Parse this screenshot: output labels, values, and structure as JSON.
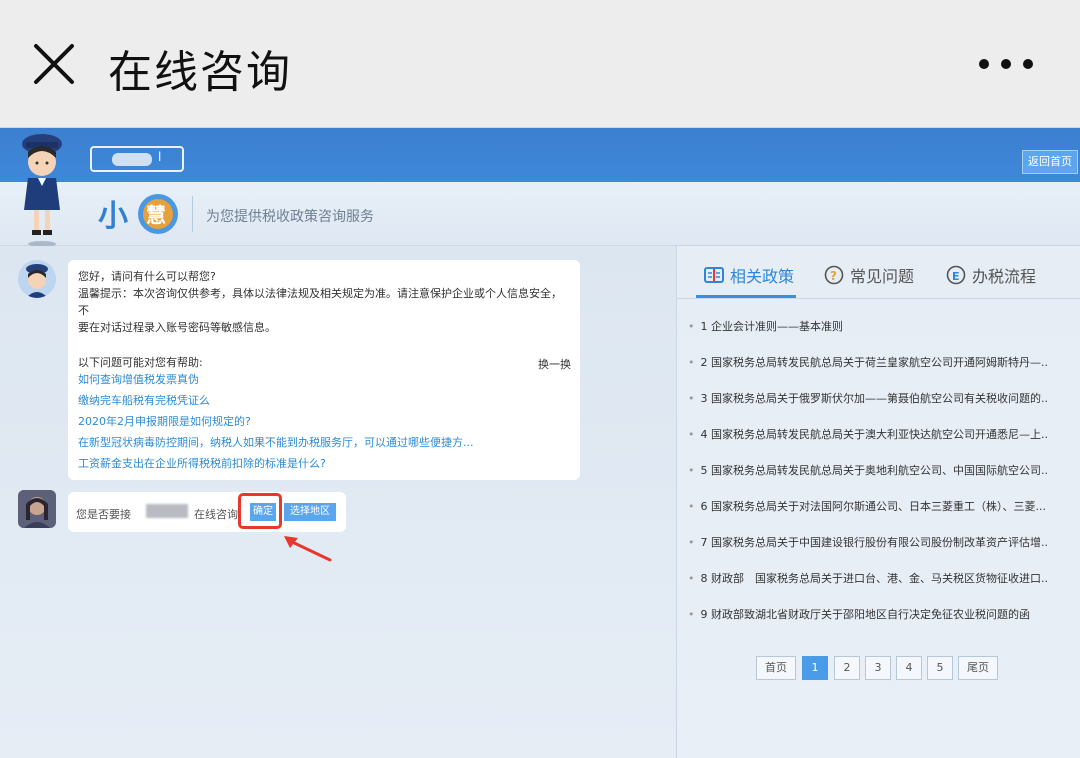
{
  "appbar": {
    "title": "在线咨询"
  },
  "header": {
    "account_suffix": "l",
    "back_home": "返回首页"
  },
  "brand": {
    "name": "小慧",
    "slogan": "为您提供税收政策咨询服务"
  },
  "chat": {
    "bot_lines": [
      "您好，请问有什么可以帮您?",
      "温馨提示：本次咨询仅供参考，具体以法律法规及相关规定为准。请注意保护企业或个人信息安全，不",
      "要在对话过程录入账号密码等敏感信息。"
    ],
    "help_title": "以下问题可能对您有帮助:",
    "swap": "换一换",
    "links": [
      "如何查询增值税发票真伪",
      "缴纳完车船税有完税凭证么",
      "2020年2月申报期限是如何规定的?",
      "在新型冠状病毒防控期间，纳税人如果不能到办税服务厅，可以通过哪些便捷方...",
      "工资薪金支出在企业所得税税前扣除的标准是什么?"
    ],
    "user_q_prefix": "您是否要接",
    "user_q_suffix": "在线咨询",
    "confirm": "确定",
    "select_region": "选择地区"
  },
  "tabs": [
    {
      "label": "相关政策",
      "icon": "policy-book-icon"
    },
    {
      "label": "常见问题",
      "icon": "question-icon"
    },
    {
      "label": "办税流程",
      "icon": "process-icon"
    }
  ],
  "policies": [
    "1 企业会计准则——基本准则",
    "2 国家税务总局转发民航总局关于荷兰皇家航空公司开通阿姆斯特丹—...",
    "3 国家税务总局关于俄罗斯伏尔加——第聂伯航空公司有关税收问题的...",
    "4 国家税务总局转发民航总局关于澳大利亚快达航空公司开通悉尼—上...",
    "5 国家税务总局转发民航总局关于奥地利航空公司、中国国际航空公司...",
    "6 国家税务总局关于对法国阿尔斯通公司、日本三菱重工（株）、三菱...",
    "7 国家税务总局关于中国建设银行股份有限公司股份制改革资产评估增...",
    "8 财政部　国家税务总局关于进口台、港、金、马关税区货物征收进口...",
    "9 财政部致湖北省财政厅关于邵阳地区自行决定免征农业税问题的函"
  ],
  "pager": {
    "first": "首页",
    "pages": [
      "1",
      "2",
      "3",
      "4",
      "5"
    ],
    "last": "尾页",
    "current": "1"
  },
  "colors": {
    "accent": "#3b8ee0",
    "highlight": "#e8372c",
    "header_blue": "#3c7fd0"
  }
}
